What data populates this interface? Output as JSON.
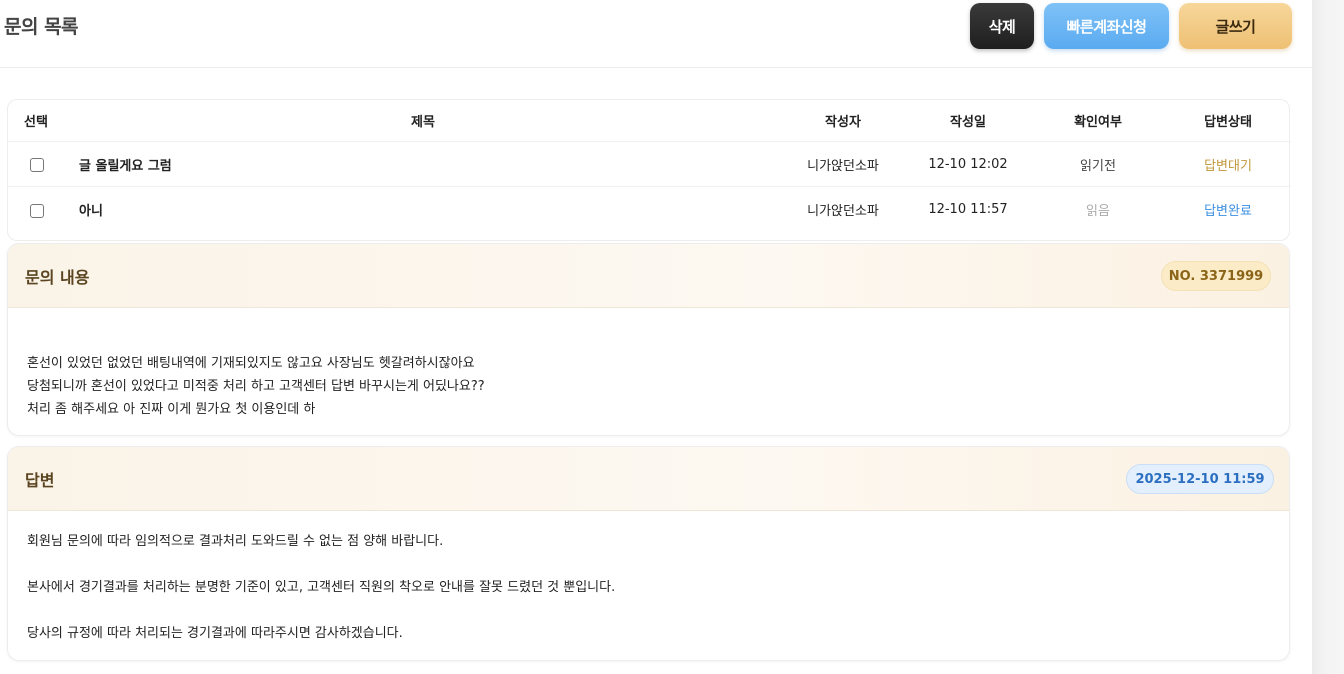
{
  "header": {
    "title": "문의 목록",
    "buttons": {
      "delete": "삭제",
      "fast_account": "빠른계좌신청",
      "write": "글쓰기"
    }
  },
  "table": {
    "columns": [
      "선택",
      "제목",
      "작성자",
      "작성일",
      "확인여부",
      "답변상태"
    ],
    "rows": [
      {
        "title": "글 올릴게요 그럼",
        "author": "니가앉던소파",
        "date": "12-10 12:02",
        "read": "읽기전",
        "status": "답변대기"
      },
      {
        "title": "아니",
        "author": "니가앉던소파",
        "date": "12-10 11:57",
        "read": "읽음",
        "status": "답변완료"
      }
    ]
  },
  "inquiry": {
    "title": "문의 내용",
    "number": "NO. 3371999",
    "lines": [
      "혼선이 있었던 없었던 배팅내역에 기재되있지도 않고요 사장님도 헷갈려하시잖아요",
      "당첨되니까 혼선이 있었다고 미적중 처리 하고 고객센터 답변 바꾸시는게 어딨나요??",
      "처리 좀 해주세요 아 진짜 이게 뭔가요 첫 이용인데 하"
    ]
  },
  "answer": {
    "title": "답변",
    "date": "2025-12-10 11:59",
    "lines": [
      "회원님 문의에 따라 임의적으로 결과처리 도와드릴 수 없는 점 양해 바랍니다.",
      "본사에서 경기결과를 처리하는 분명한 기준이 있고, 고객센터 직원의 착오로 안내를 잘못 드렸던 것 뿐입니다.",
      "당사의 규정에 따라 처리되는 경기결과에 따라주시면 감사하겠습니다."
    ]
  },
  "colors": {
    "status_waiting": "#c0973a",
    "status_done": "#3b8fe0",
    "button_delete": "#2a2a2a",
    "button_fast": "#6bb5f3",
    "button_write": "#f2c97f"
  }
}
